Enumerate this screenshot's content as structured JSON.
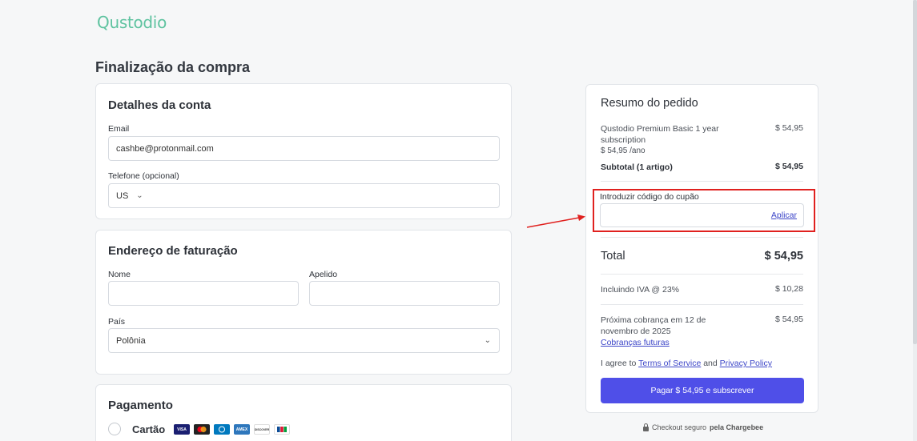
{
  "brand": {
    "logo": "Qustodio",
    "logo_color": "#5fc3a0"
  },
  "page": {
    "title": "Finalização da compra"
  },
  "account": {
    "heading": "Detalhes da conta",
    "email_label": "Email",
    "email_value": "cashbe@protonmail.com",
    "phone_label": "Telefone (opcional)",
    "phone_country": "US"
  },
  "billing": {
    "heading": "Endereço de faturação",
    "name_label": "Nome",
    "surname_label": "Apelido",
    "country_label": "País",
    "country_value": "Polônia"
  },
  "payment": {
    "heading": "Pagamento",
    "method_label": "Cartão",
    "card_icons": [
      "visa-icon",
      "mastercard-icon",
      "diners-icon",
      "amex-icon",
      "discover-icon",
      "jcb-icon"
    ],
    "card_labels": [
      "VISA",
      "",
      "",
      "AMEX",
      "DISCOVER",
      ""
    ]
  },
  "summary": {
    "title": "Resumo do pedido",
    "item_name": "Qustodio Premium Basic 1 year subscription",
    "item_price": "$ 54,95",
    "item_rate": "$ 54,95 /ano",
    "subtotal_label": "Subtotal (1 artigo)",
    "subtotal_value": "$ 54,95",
    "coupon_label": "Introduzir código do cupão",
    "coupon_apply": "Aplicar",
    "total_label": "Total",
    "total_value": "$ 54,95",
    "vat_label": "Incluindo IVA @ 23%",
    "vat_value": "$ 10,28",
    "next_charge_label": "Próxima cobrança em 12 de novembro de 2025",
    "next_charge_value": "$ 54,95",
    "future_charges_link": "Cobranças futuras",
    "agree_prefix": "I agree to",
    "terms_link": "Terms of Service",
    "agree_and": "and",
    "privacy_link": "Privacy Policy",
    "pay_button": "Pagar $ 54,95 e subscrever",
    "pay_button_color": "#4f4fe8"
  },
  "footer": {
    "secure_prefix": "Checkout seguro",
    "secure_by": "pela Chargebee"
  },
  "annotation": {
    "highlight_color": "#e0211f"
  }
}
